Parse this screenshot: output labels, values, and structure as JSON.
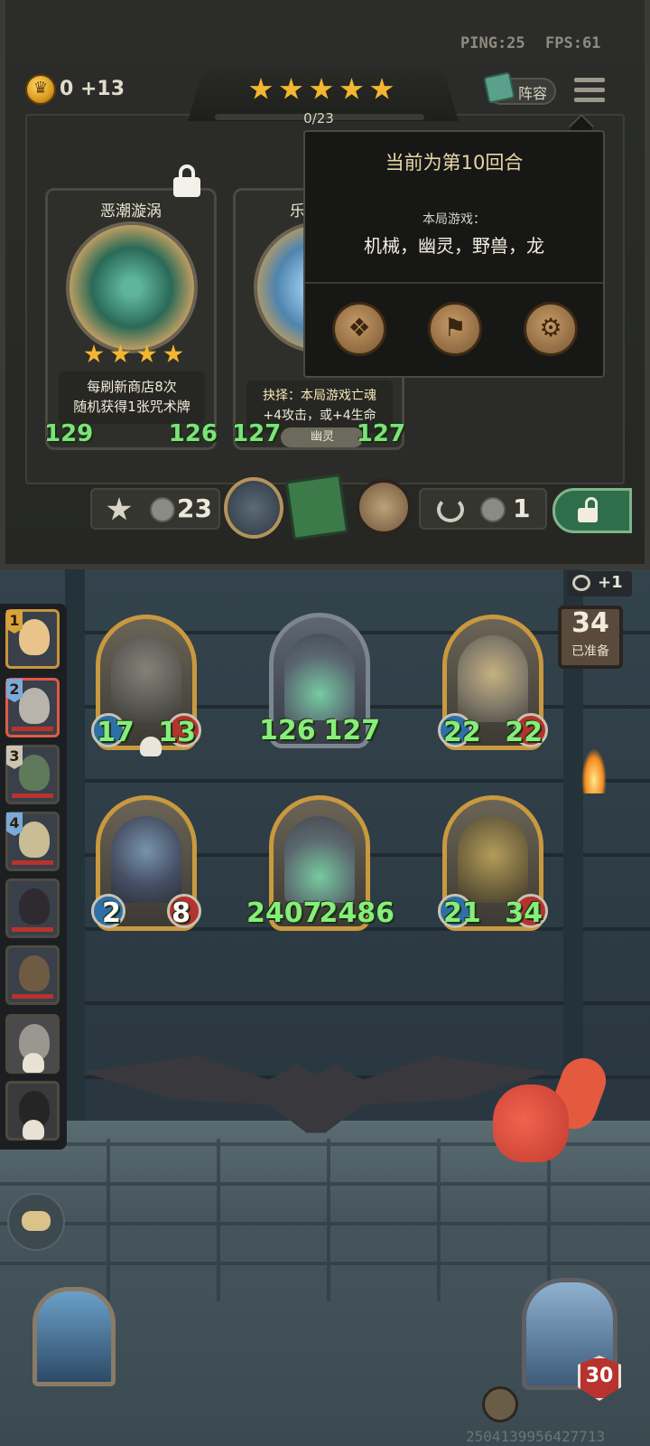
{
  "status": {
    "ping": "PING:25",
    "fps": "FPS:61"
  },
  "gold": {
    "text": "0 +13"
  },
  "tavern": {
    "stars": 5,
    "xp": "0/23"
  },
  "lineup_button": {
    "label": "阵容"
  },
  "shop_cards": [
    {
      "title": "恶潮漩涡",
      "stars": 4,
      "desc_line1": "每刷新商店8次",
      "desc_line2": "随机获得1张咒术牌",
      "attack": "129",
      "health": "126",
      "locked": true
    },
    {
      "title": "乐",
      "desc_line1": "抉择：本局游戏亡魂",
      "desc_line2": "+4攻击，或+4生命",
      "tribe": "幽灵",
      "attack": "127",
      "health": "127"
    }
  ],
  "round_popup": {
    "round_text": "当前为第10回合",
    "game_label": "本局游戏：",
    "tribes": "机械，幽灵，野兽，龙"
  },
  "shop_bar": {
    "upgrade_cost": "23",
    "refresh_cost": "1"
  },
  "board": {
    "minions": [
      {
        "name": "hawk",
        "attack": "17",
        "health": "13",
        "frame": "gold",
        "dead_marker": true
      },
      {
        "name": "dragon-top",
        "attack": "126",
        "health": "127",
        "frame": "silver"
      },
      {
        "name": "windmill",
        "attack": "22",
        "health": "22",
        "frame": "gold"
      },
      {
        "name": "elf-woman",
        "attack": "2",
        "health": "8",
        "frame": "gold"
      },
      {
        "name": "dragon-bottom",
        "attack": "2407",
        "health": "2486",
        "frame": "gold"
      },
      {
        "name": "mech-golem",
        "attack": "21",
        "health": "34",
        "frame": "gold"
      }
    ]
  },
  "roster": [
    {
      "rank": "1",
      "style": "gold"
    },
    {
      "rank": "2",
      "style": "active"
    },
    {
      "rank": "3",
      "style": "normal"
    },
    {
      "rank": "4",
      "style": "normal"
    },
    {
      "rank": "",
      "style": "normal"
    },
    {
      "rank": "",
      "style": "normal"
    },
    {
      "rank": "",
      "style": "dead"
    },
    {
      "rank": "",
      "style": "dead"
    }
  ],
  "side_counter": {
    "eye_text": "+1",
    "ready_count": "34",
    "ready_label": "已准备"
  },
  "hero": {
    "health": "30"
  },
  "player_id": "2504139956427713",
  "colors": {
    "gold": "#f2b630",
    "attack_text": "#86ee7a",
    "panel": "#2c2d2a"
  }
}
